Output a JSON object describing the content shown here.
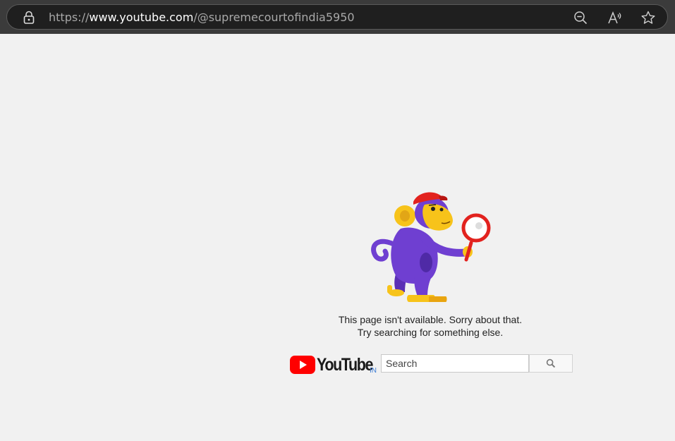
{
  "browser": {
    "url_scheme": "https://",
    "url_domain": "www.youtube.com",
    "url_path": "/@supremecourtofindia5950",
    "icons": [
      "lock-icon",
      "zoom-out-icon",
      "read-aloud-icon",
      "favorite-star-icon"
    ]
  },
  "error_page": {
    "illustration": "monkey-with-magnifier",
    "line1": "This page isn't available. Sorry about that.",
    "line2": "Try searching for something else."
  },
  "logo": {
    "wordmark": "YouTube",
    "country_code": "IN"
  },
  "search": {
    "placeholder": "Search",
    "button_icon": "search-icon"
  },
  "colors": {
    "page_background": "#f1f1f1",
    "browser_bar": "#3b3b3b",
    "youtube_red": "#ff0000",
    "monkey_purple": "#6f3fd1"
  }
}
